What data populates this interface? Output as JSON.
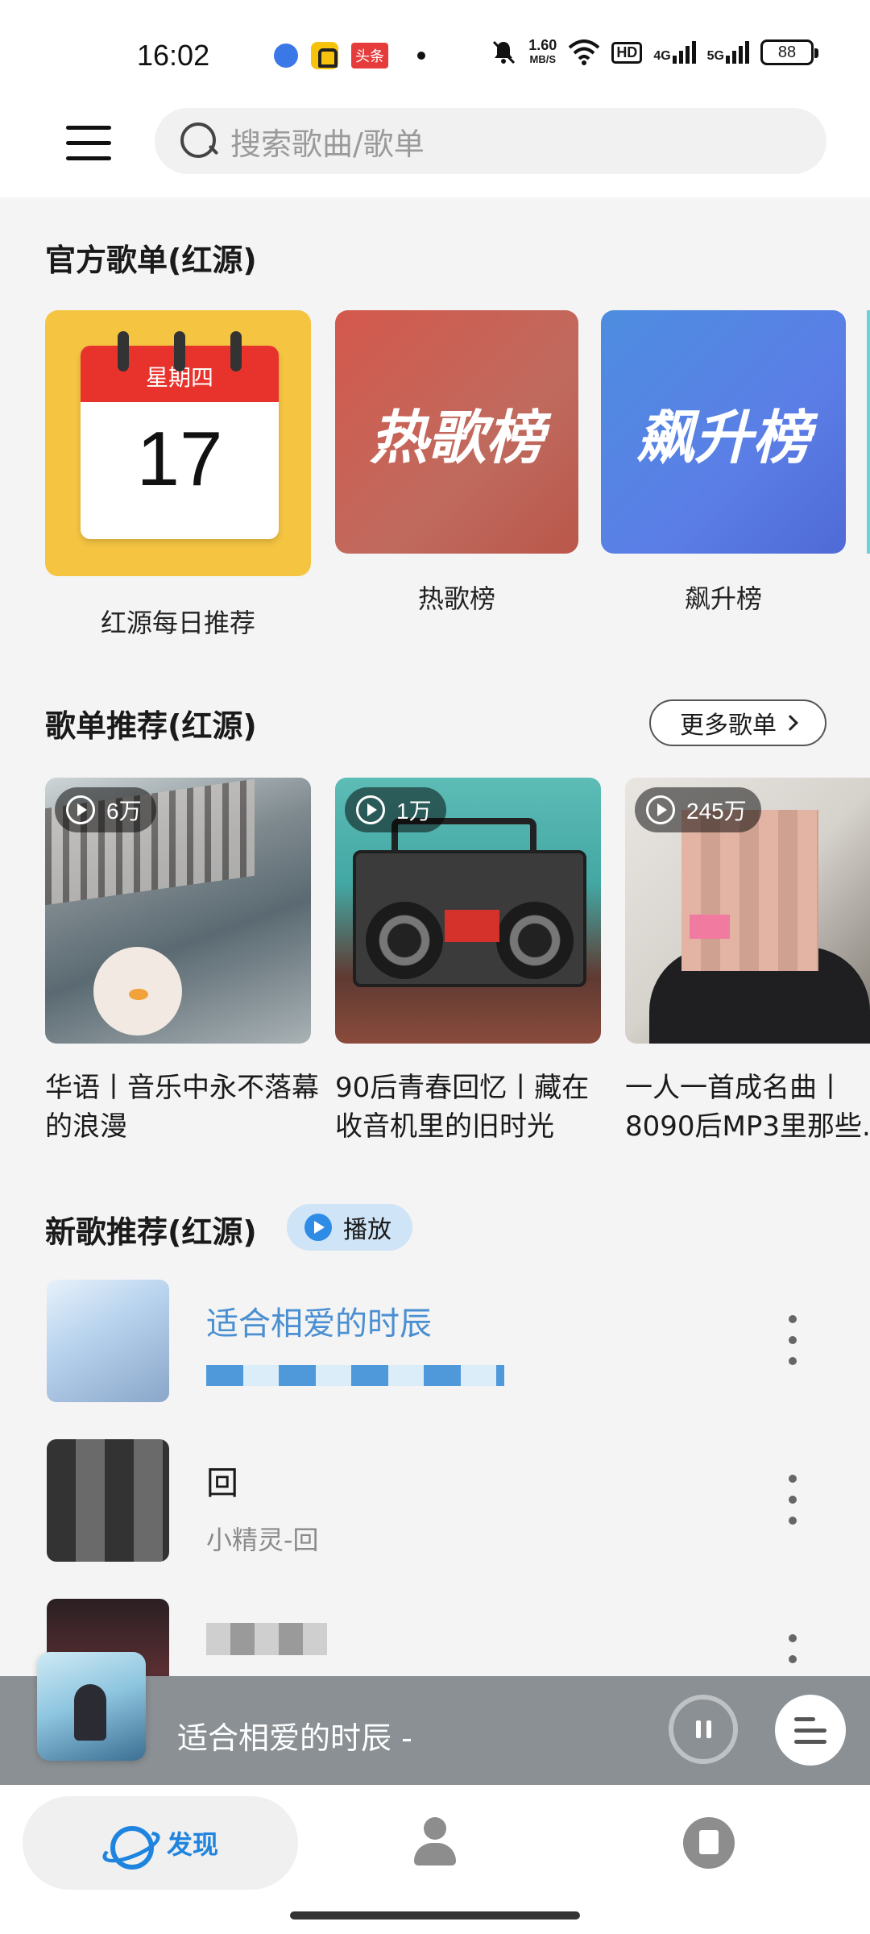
{
  "status_bar": {
    "time": "16:02",
    "toutiao_badge": "头条",
    "net_speed_value": "1.60",
    "net_speed_unit": "MB/S",
    "hd_label": "HD",
    "network_1": "4G",
    "network_2": "5G",
    "battery": "88"
  },
  "search": {
    "placeholder": "搜索歌曲/歌单"
  },
  "official": {
    "title": "官方歌单(红源)",
    "cards": [
      {
        "label": "红源每日推荐",
        "calendar_weekday": "星期四",
        "calendar_day": "17"
      },
      {
        "label": "热歌榜",
        "cover_text": "热歌榜"
      },
      {
        "label": "飙升榜",
        "cover_text": "飙升榜"
      }
    ]
  },
  "playlists": {
    "title": "歌单推荐(红源)",
    "more_label": "更多歌单",
    "items": [
      {
        "plays": "6万",
        "title": "华语丨音乐中永不落幕的浪漫"
      },
      {
        "plays": "1万",
        "title": "90后青春回忆丨藏在收音机里的旧时光"
      },
      {
        "plays": "245万",
        "title": "一人一首成名曲丨8090后MP3里那些..."
      }
    ]
  },
  "new_songs": {
    "title": "新歌推荐(红源)",
    "play_label": "播放",
    "items": [
      {
        "title": "适合相爱的时辰",
        "subtitle": ""
      },
      {
        "title": "回",
        "subtitle": "小精灵-回"
      },
      {
        "title": "",
        "subtitle": ""
      }
    ]
  },
  "mini_player": {
    "title": "适合相爱的时辰 -"
  },
  "bottom_nav": {
    "discover_label": "发现"
  },
  "colors": {
    "accent": "#1f84e0",
    "hot_chart": "#c9584c",
    "rise_chart": "#4f86df",
    "calendar_bg": "#f5c542"
  },
  "icons": [
    "menu-icon",
    "search-icon",
    "play-icon",
    "more-icon",
    "pause-icon",
    "playlist-icon",
    "planet-icon",
    "person-icon",
    "book-icon"
  ]
}
